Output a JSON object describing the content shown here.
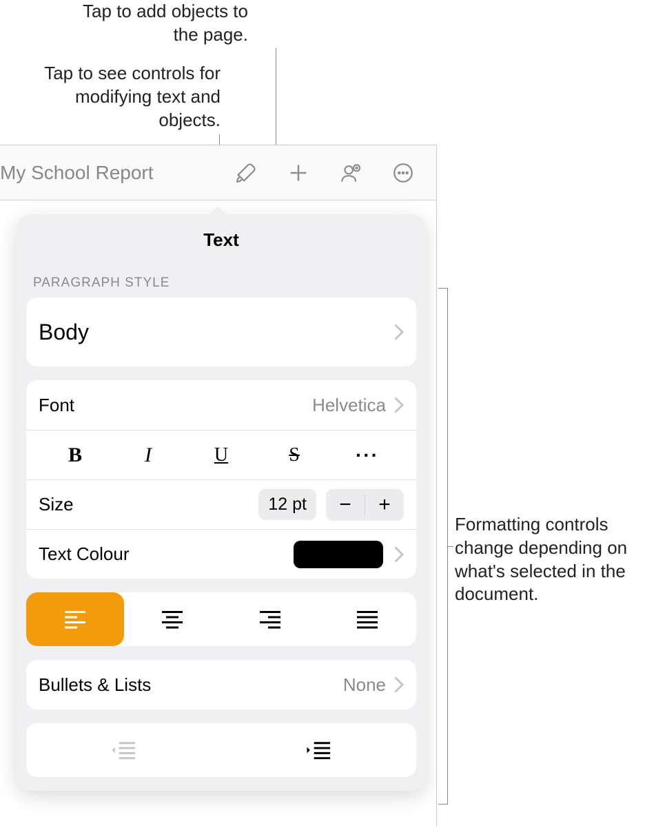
{
  "callouts": {
    "add_objects": "Tap to add objects to the page.",
    "format_controls": "Tap to see controls for modifying text and objects.",
    "side_note": "Formatting controls change depending on what's selected in the document."
  },
  "toolbar": {
    "title": "My School Report"
  },
  "popover": {
    "header": "Text",
    "paragraph_style_label": "PARAGRAPH STYLE",
    "paragraph_style_value": "Body",
    "font_label": "Font",
    "font_value": "Helvetica",
    "size_label": "Size",
    "size_value": "12 pt",
    "colour_label": "Text Colour",
    "colour_value": "#000000",
    "bullets_label": "Bullets & Lists",
    "bullets_value": "None",
    "alignment_selected": "left",
    "style_buttons": {
      "bold": "B",
      "italic": "I",
      "underline": "U",
      "strike": "S",
      "more": "···"
    },
    "stepper": {
      "minus": "−",
      "plus": "+"
    }
  }
}
